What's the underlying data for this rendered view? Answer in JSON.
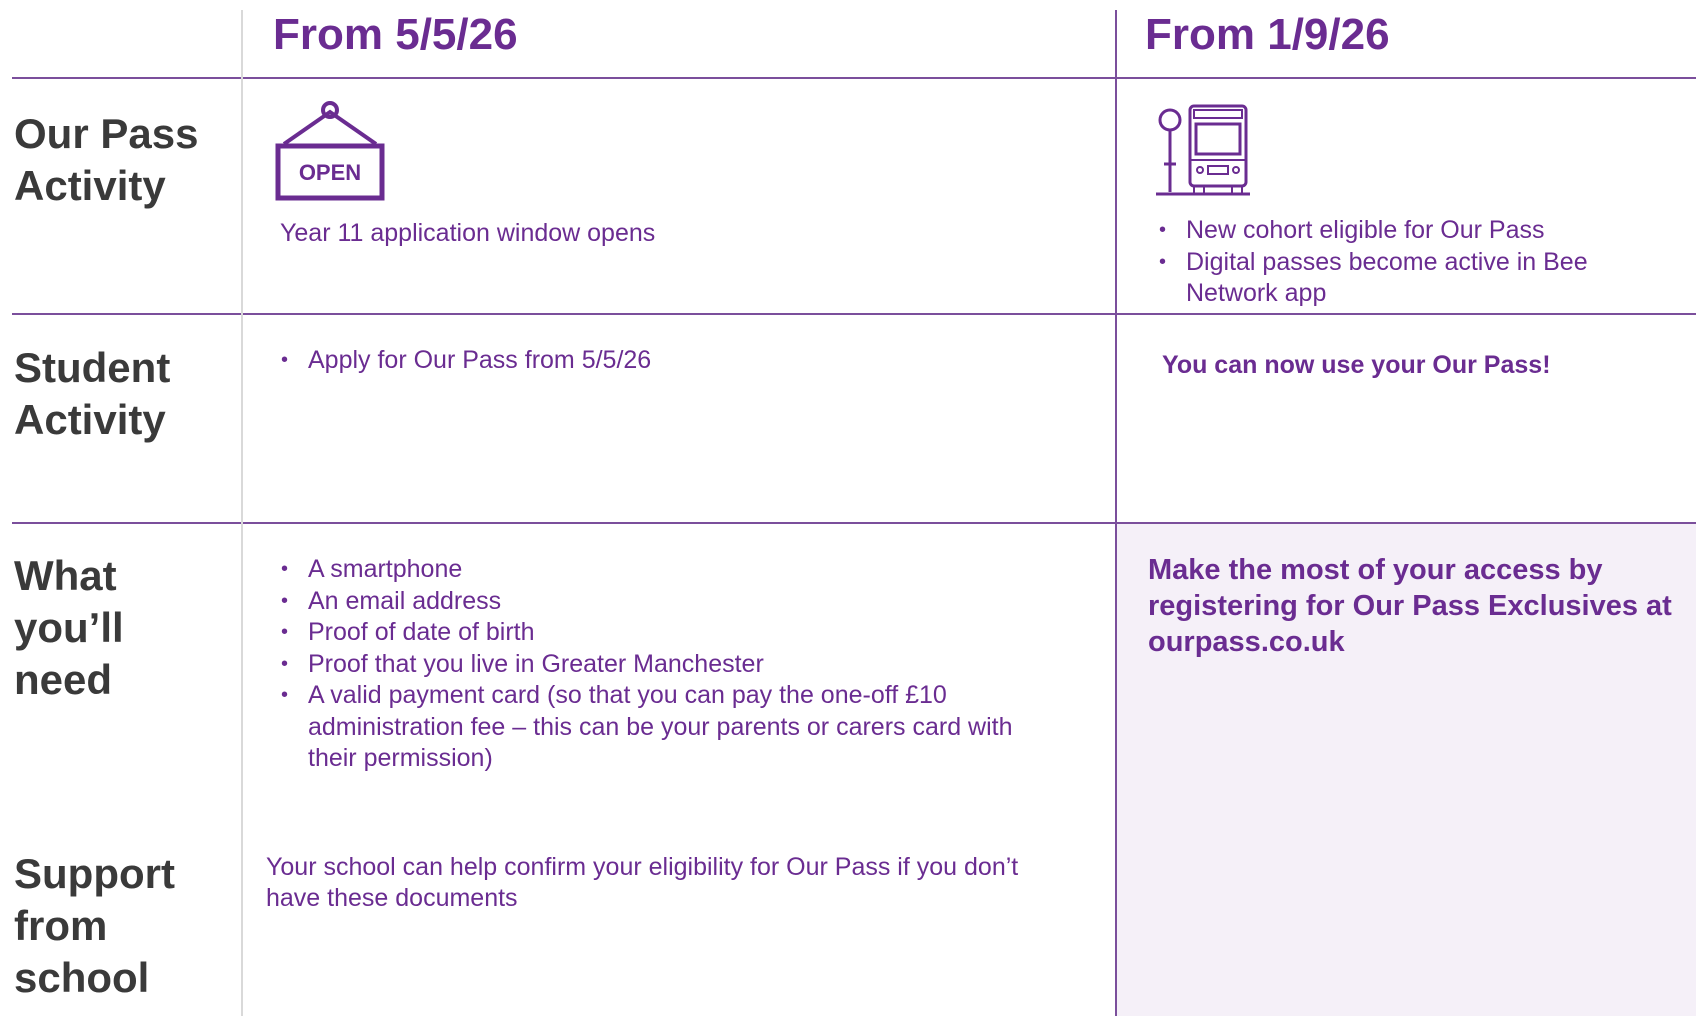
{
  "columns": {
    "left_heading": "From 5/5/26",
    "right_heading": "From 1/9/26"
  },
  "rows": {
    "our_pass_activity": {
      "label_lines": [
        "Our Pass",
        "Activity"
      ],
      "left_icon": "open-sign-icon",
      "left_icon_text": "OPEN",
      "left_text": "Year 11 application window opens",
      "right_icon": "bus-stop-icon",
      "right_bullets": [
        "New cohort eligible for Our Pass",
        "Digital passes become active in Bee Network app"
      ]
    },
    "student_activity": {
      "label_lines": [
        "Student",
        "Activity"
      ],
      "left_bullets": [
        "Apply for Our Pass from 5/5/26"
      ],
      "right_text": "You can now use your Our Pass!"
    },
    "what_youll_need": {
      "label_lines": [
        "What",
        "you’ll",
        "need"
      ],
      "left_bullets": [
        "A smartphone",
        "An email address",
        "Proof of date of birth",
        "Proof that you live in Greater Manchester",
        "A valid payment card (so that you can pay the one-off £10 administration fee – this can be your parents or carers card with their permission)"
      ],
      "right_text": "Make the most of your access by registering for Our Pass Exclusives at ourpass.co.uk"
    },
    "support_from_school": {
      "label_lines": [
        "Support",
        "from",
        "school"
      ],
      "left_text": "Your school can help confirm your eligibility for Our Pass if you don’t have these documents"
    }
  },
  "colors": {
    "accent": "#6a2c91",
    "label": "#3a3a3a",
    "divider": "#7b4f9c",
    "panel": "#f5f0f8"
  }
}
